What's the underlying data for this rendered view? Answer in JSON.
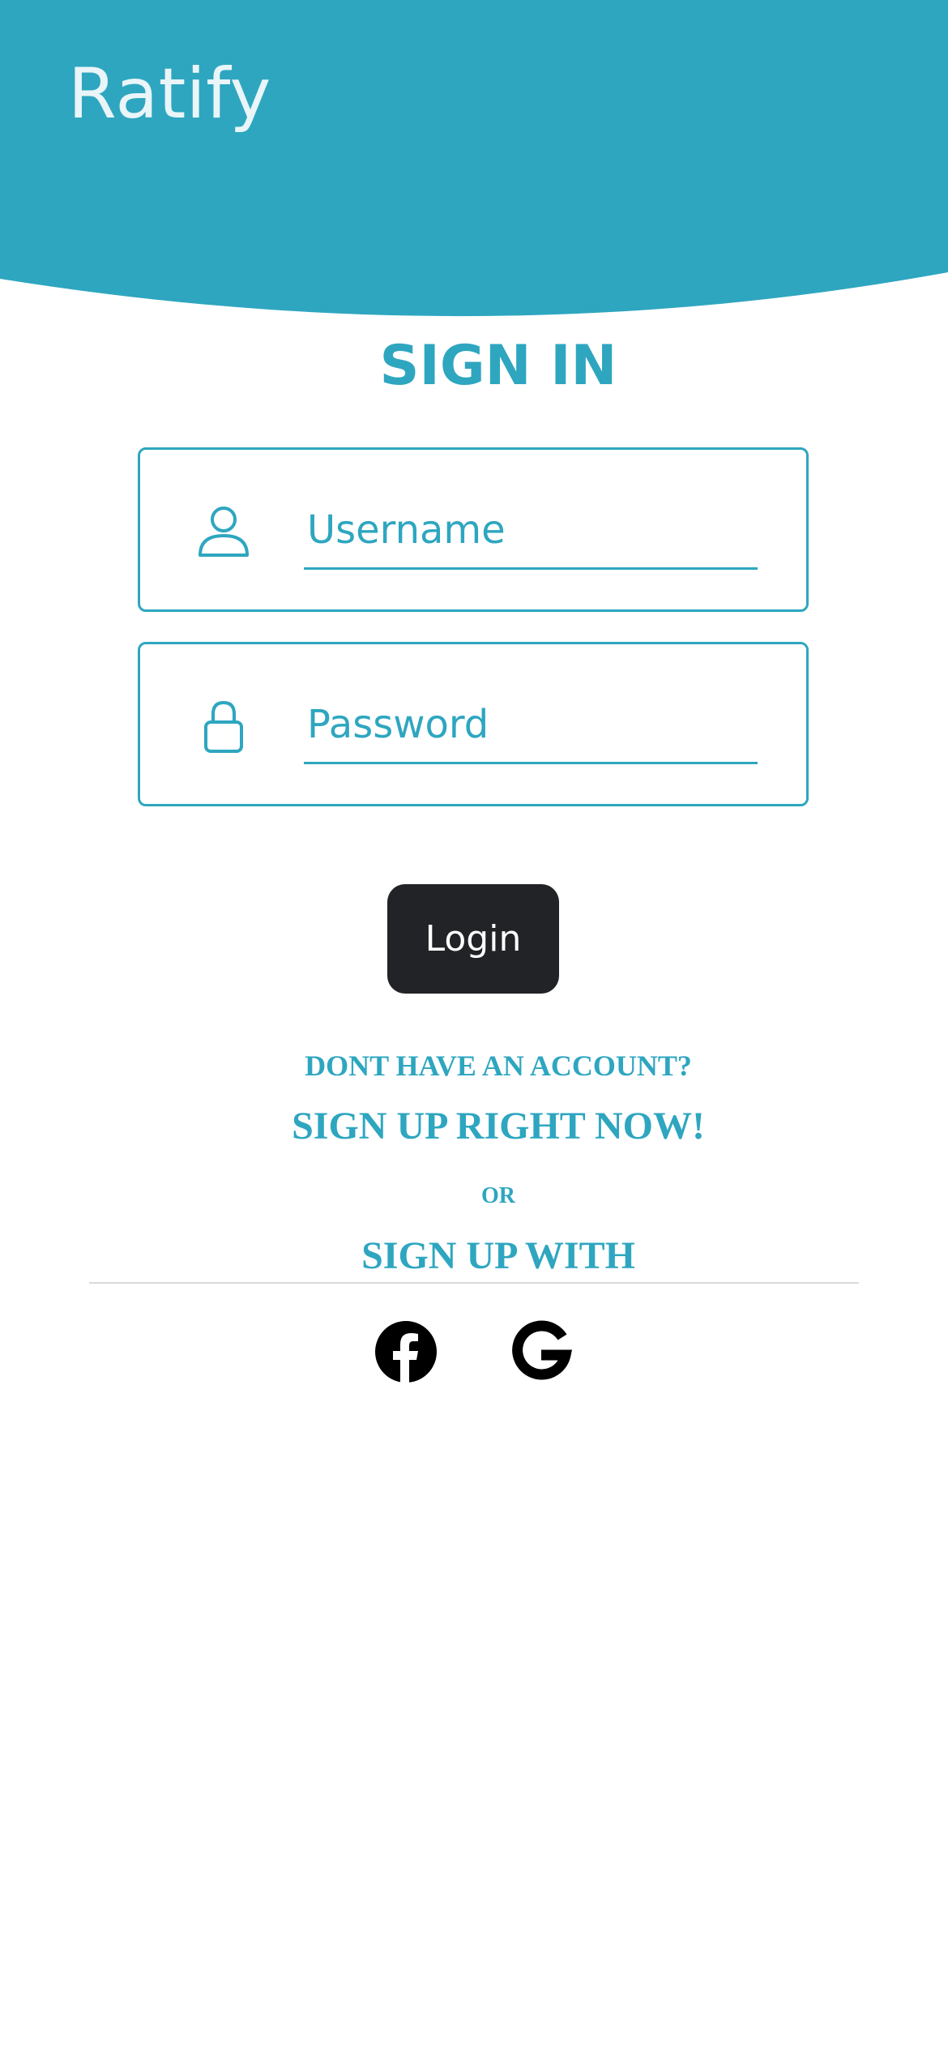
{
  "header": {
    "app_title": "Ratify",
    "background_color": "#2ea6c0"
  },
  "form": {
    "title": "SIGN IN",
    "username": {
      "placeholder": "Username",
      "value": "",
      "icon": "user-icon"
    },
    "password": {
      "placeholder": "Password",
      "value": "",
      "icon": "lock-icon"
    },
    "login_label": "Login"
  },
  "signup": {
    "prompt": "DONT HAVE AN ACCOUNT?",
    "link": "SIGN UP RIGHT NOW!",
    "or": "OR",
    "with": "SIGN UP WITH"
  },
  "social": [
    {
      "name": "facebook",
      "icon": "facebook-icon"
    },
    {
      "name": "google",
      "icon": "google-icon"
    }
  ],
  "colors": {
    "accent": "#2ea6c0",
    "button": "#222326",
    "title_text": "#e9f5f8"
  }
}
